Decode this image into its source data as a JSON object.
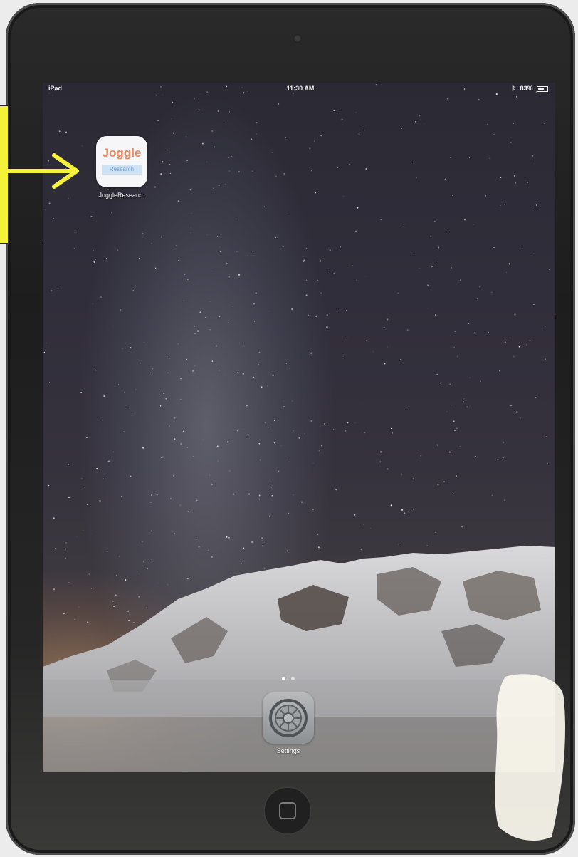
{
  "status_bar": {
    "device": "iPad",
    "time": "11:30 AM",
    "battery": "83%"
  },
  "home_screen": {
    "apps": [
      {
        "label": "JoggleResearch",
        "icon_title": "Joggle",
        "icon_subtitle": "Research",
        "icon": "joggle-research-icon"
      }
    ],
    "page_dots": 2,
    "active_page": 1
  },
  "dock": {
    "apps": [
      {
        "label": "Settings",
        "icon": "settings-gear-icon"
      }
    ]
  },
  "annotation": {
    "color": "#f5f03a",
    "icon": "yellow-arrow-icon"
  },
  "colors": {
    "joggle_orange": "#e58a62",
    "research_blue": "#6e9fd0"
  }
}
